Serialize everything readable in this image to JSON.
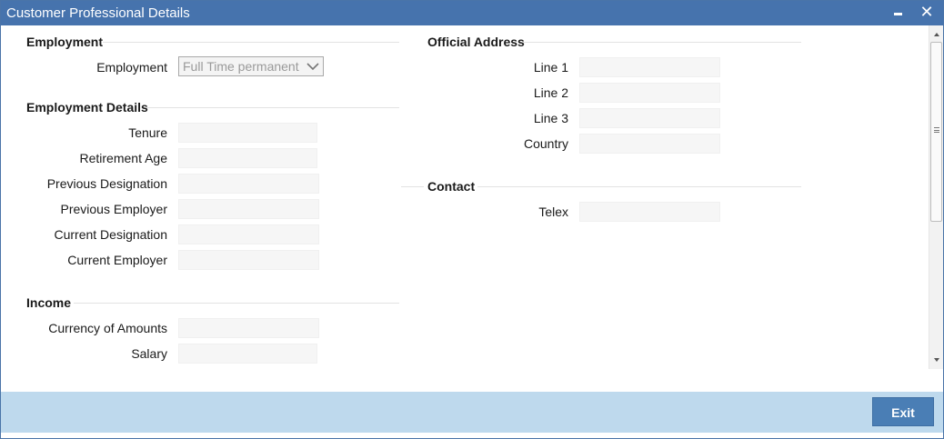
{
  "window": {
    "title": "Customer Professional Details"
  },
  "employment": {
    "title": "Employment",
    "label": "Employment",
    "selected": "Full Time permanent"
  },
  "employment_details": {
    "title": "Employment Details",
    "fields": [
      {
        "label": "Tenure",
        "value": ""
      },
      {
        "label": "Retirement Age",
        "value": ""
      },
      {
        "label": "Previous Designation",
        "value": ""
      },
      {
        "label": "Previous Employer",
        "value": ""
      },
      {
        "label": "Current Designation",
        "value": ""
      },
      {
        "label": "Current Employer",
        "value": ""
      }
    ]
  },
  "income": {
    "title": "Income",
    "fields": [
      {
        "label": "Currency of Amounts",
        "value": ""
      },
      {
        "label": "Salary",
        "value": ""
      }
    ]
  },
  "official_address": {
    "title": "Official Address",
    "fields": [
      {
        "label": "Line 1",
        "value": ""
      },
      {
        "label": "Line 2",
        "value": ""
      },
      {
        "label": "Line 3",
        "value": ""
      },
      {
        "label": "Country",
        "value": ""
      }
    ]
  },
  "contact": {
    "title": "Contact",
    "fields": [
      {
        "label": "Telex",
        "value": ""
      }
    ]
  },
  "footer": {
    "exit_label": "Exit"
  },
  "colors": {
    "titlebar": "#4673ad",
    "footer": "#bed9ed",
    "button": "#4a7eb5"
  },
  "icons": {
    "minimize": "minimize-icon",
    "close": "close-icon",
    "dropdown": "chevron-down-icon"
  }
}
